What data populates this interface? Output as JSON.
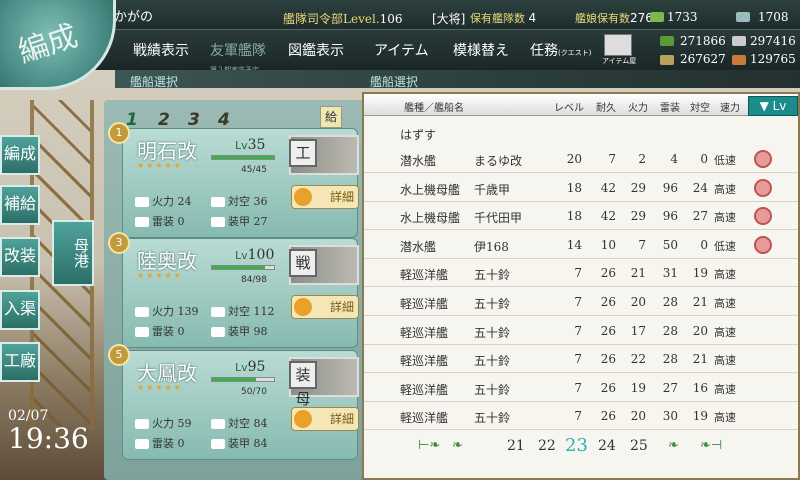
{
  "header": {
    "player_name": "かがの",
    "hq_label": "艦隊司令部Level.",
    "hq_level": "106",
    "rank": "[大将]",
    "ship_count_label": "保有艦隊数",
    "ship_count": "4",
    "girl_count_label": "艦娘保有数",
    "girl_count": "276",
    "bucket": "1733",
    "devmat": "1708",
    "fuel": "271866",
    "ammo": "267627",
    "steel": "297416",
    "bauxite": "129765"
  },
  "menu": {
    "logo": "編成",
    "items": [
      "戦績表示",
      "友軍艦隊",
      "図鑑表示",
      "アイテム",
      "模様替え",
      "任務"
    ],
    "friend_sub": "第２期実装予定",
    "quest_sub": "(クエスト)",
    "item_shop": "アイテム屋"
  },
  "crumbs": {
    "left": "艦船選択",
    "right": "艦船選択"
  },
  "nav": [
    "編成",
    "補給",
    "改装",
    "入渠",
    "工廠"
  ],
  "supply_btn": "母港",
  "datetime": {
    "date": "02/07",
    "time": "19:36"
  },
  "fleet_tabs": [
    "1",
    "2",
    "3",
    "4"
  ],
  "fleet_sub": "給",
  "ships": [
    {
      "slot": "1",
      "name": "明石改",
      "lv": "35",
      "stars": "★★★★★",
      "hp": "45/45",
      "hp_frac": 1.0,
      "fire": "24",
      "aa": "36",
      "torp": "0",
      "armor": "27",
      "type": "工",
      "detail": "詳細"
    },
    {
      "slot": "3",
      "name": "陸奥改",
      "lv": "100",
      "stars": "★★★★★",
      "hp": "84/98",
      "hp_frac": 0.857,
      "fire": "139",
      "aa": "112",
      "torp": "0",
      "armor": "98",
      "type": "戦",
      "detail": "詳細"
    },
    {
      "slot": "5",
      "name": "大鳳改",
      "lv": "95",
      "stars": "★★★★★",
      "hp": "50/70",
      "hp_frac": 0.714,
      "fire": "59",
      "aa": "84",
      "torp": "0",
      "armor": "84",
      "type": "装母",
      "detail": "詳細"
    }
  ],
  "stat_labels": {
    "lv": "Lv",
    "fire": "火力",
    "aa": "対空",
    "torp": "雷装",
    "armor": "装甲"
  },
  "list": {
    "headers": {
      "name": "艦種／艦船名",
      "lv": "レベル",
      "hp": "耐久",
      "fire": "火力",
      "torp": "雷装",
      "aa": "対空",
      "speed": "速力"
    },
    "sort": "▼ Lv",
    "remove": "はずす",
    "rows": [
      {
        "type": "潜水艦",
        "name": "まるゆ改",
        "lv": "20",
        "hp": "7",
        "fire": "2",
        "torp": "4",
        "aa": "0",
        "speed": "低速",
        "locked": true
      },
      {
        "type": "水上機母艦",
        "name": "千歳甲",
        "lv": "18",
        "hp": "42",
        "fire": "29",
        "torp": "96",
        "aa": "24",
        "speed": "高速",
        "locked": true
      },
      {
        "type": "水上機母艦",
        "name": "千代田甲",
        "lv": "18",
        "hp": "42",
        "fire": "29",
        "torp": "96",
        "aa": "27",
        "speed": "高速",
        "locked": true
      },
      {
        "type": "潜水艦",
        "name": "伊168",
        "lv": "14",
        "hp": "10",
        "fire": "7",
        "torp": "50",
        "aa": "0",
        "speed": "低速",
        "locked": true
      },
      {
        "type": "軽巡洋艦",
        "name": "五十鈴",
        "lv": "7",
        "hp": "26",
        "fire": "21",
        "torp": "31",
        "aa": "19",
        "speed": "高速",
        "locked": false
      },
      {
        "type": "軽巡洋艦",
        "name": "五十鈴",
        "lv": "7",
        "hp": "26",
        "fire": "20",
        "torp": "28",
        "aa": "21",
        "speed": "高速",
        "locked": false
      },
      {
        "type": "軽巡洋艦",
        "name": "五十鈴",
        "lv": "7",
        "hp": "26",
        "fire": "17",
        "torp": "28",
        "aa": "20",
        "speed": "高速",
        "locked": false
      },
      {
        "type": "軽巡洋艦",
        "name": "五十鈴",
        "lv": "7",
        "hp": "26",
        "fire": "22",
        "torp": "28",
        "aa": "21",
        "speed": "高速",
        "locked": false
      },
      {
        "type": "軽巡洋艦",
        "name": "五十鈴",
        "lv": "7",
        "hp": "26",
        "fire": "19",
        "torp": "27",
        "aa": "16",
        "speed": "高速",
        "locked": false
      },
      {
        "type": "軽巡洋艦",
        "name": "五十鈴",
        "lv": "7",
        "hp": "26",
        "fire": "20",
        "torp": "30",
        "aa": "19",
        "speed": "高速",
        "locked": false
      }
    ],
    "pages": [
      "21",
      "22",
      "23",
      "24",
      "25"
    ],
    "current_page": "23"
  }
}
